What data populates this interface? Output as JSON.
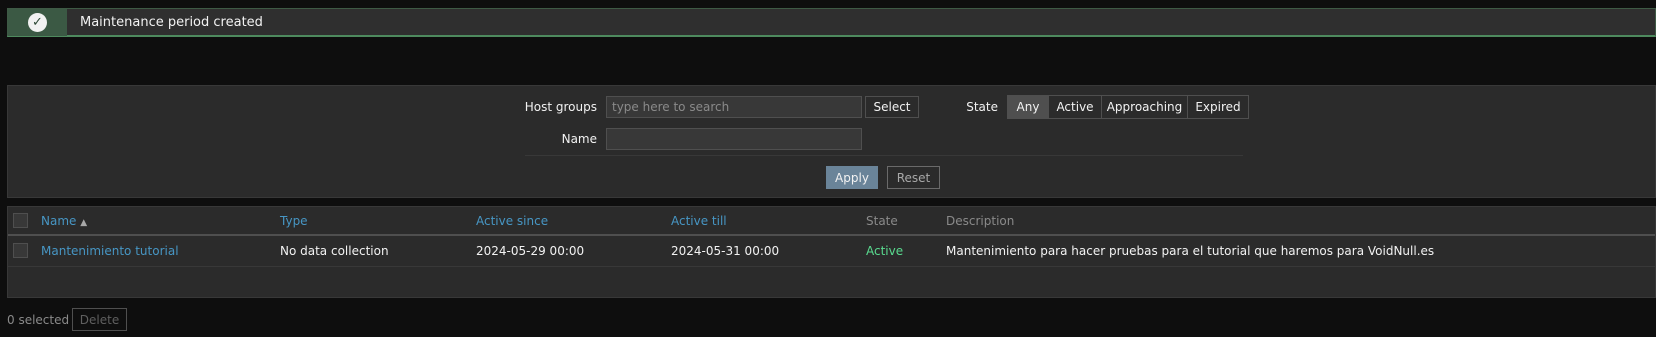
{
  "message": {
    "icon": "check-circle-icon",
    "text": "Maintenance period created"
  },
  "filter": {
    "host_groups_label": "Host groups",
    "host_groups_placeholder": "type here to search",
    "select_label": "Select",
    "name_label": "Name",
    "name_value": "",
    "state_label": "State",
    "state_options": [
      "Any",
      "Active",
      "Approaching",
      "Expired"
    ],
    "state_selected": "Any",
    "apply_label": "Apply",
    "reset_label": "Reset"
  },
  "table": {
    "columns": {
      "name": "Name",
      "sort_icon": "sort-ascending-icon",
      "type": "Type",
      "active_since": "Active since",
      "active_till": "Active till",
      "state": "State",
      "description": "Description"
    },
    "rows": [
      {
        "name": "Mantenimiento tutorial",
        "type": "No data collection",
        "active_since": "2024-05-29 00:00",
        "active_till": "2024-05-31 00:00",
        "state": "Active",
        "description": "Mantenimiento para hacer pruebas para el tutorial que haremos para VoidNull.es"
      }
    ]
  },
  "footer": {
    "selected_text": "0 selected",
    "delete_label": "Delete"
  },
  "colors": {
    "link": "#4796c4",
    "state_active": "#59db8f",
    "apply_button": "#6a8499",
    "success": "#3b5944"
  }
}
